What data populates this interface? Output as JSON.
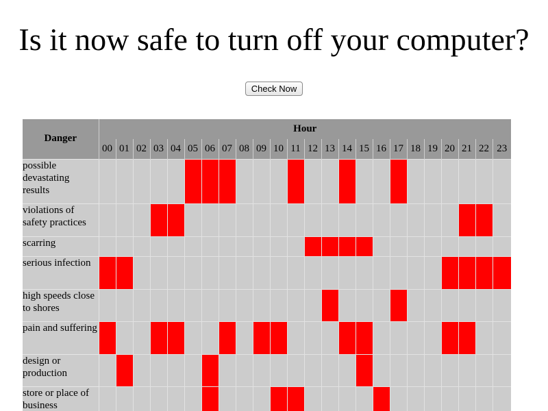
{
  "page": {
    "title": "Is it now safe to turn off your computer?",
    "button_label": "Check Now"
  },
  "table": {
    "danger_header": "Danger",
    "hour_header": "Hour",
    "hours": [
      "00",
      "01",
      "02",
      "03",
      "04",
      "05",
      "06",
      "07",
      "08",
      "09",
      "10",
      "11",
      "12",
      "13",
      "14",
      "15",
      "16",
      "17",
      "18",
      "19",
      "20",
      "21",
      "22",
      "23"
    ],
    "highlight_color": "#ff0000",
    "cell_color": "#cccccc",
    "header_color": "#999999",
    "rows": [
      {
        "label": "possible devastating results",
        "active_hours": [
          5,
          6,
          7,
          11,
          14,
          17
        ]
      },
      {
        "label": "violations of safety practices",
        "active_hours": [
          3,
          4,
          21,
          22
        ]
      },
      {
        "label": "scarring",
        "active_hours": [
          12,
          13,
          14,
          15
        ]
      },
      {
        "label": "serious infection",
        "active_hours": [
          0,
          1,
          20,
          21,
          22,
          23
        ]
      },
      {
        "label": "high speeds close to shores",
        "active_hours": [
          13,
          17
        ]
      },
      {
        "label": "pain and suffering",
        "active_hours": [
          0,
          3,
          4,
          7,
          9,
          10,
          14,
          15,
          20,
          21
        ]
      },
      {
        "label": "design or production",
        "active_hours": [
          1,
          6,
          15
        ]
      },
      {
        "label": "store or place of business",
        "active_hours": [
          6,
          10,
          11,
          16
        ]
      }
    ]
  }
}
